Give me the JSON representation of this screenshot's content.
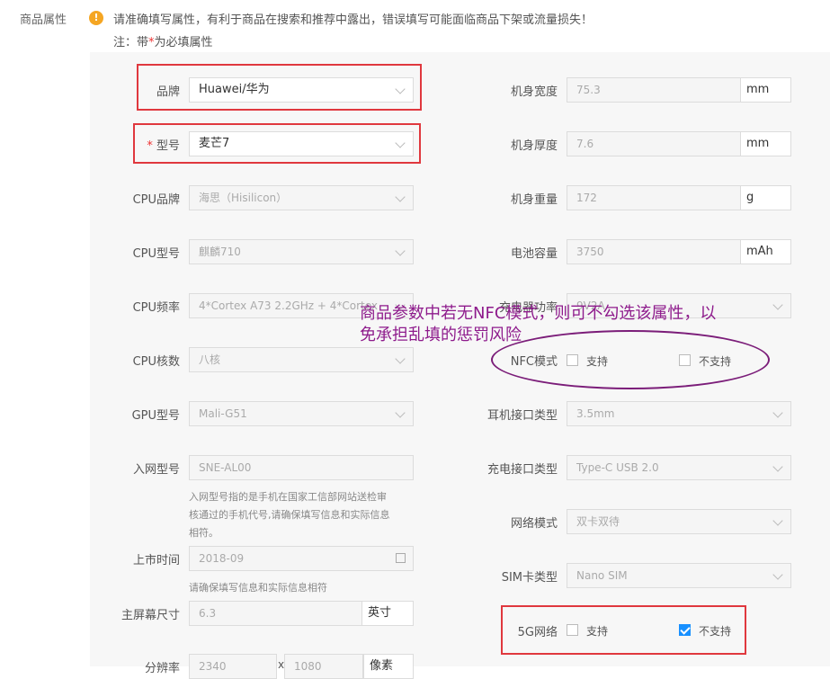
{
  "section_label": "商品属性",
  "warning": {
    "icon": "exclamation-icon",
    "icon_glyph": "!",
    "text": "请准确填写属性，有利于商品在搜索和推荐中露出，错误填写可能面临商品下架或流量损失！"
  },
  "note": {
    "prefix": "注：带",
    "star": "*",
    "suffix": "为必填属性"
  },
  "left": {
    "brand": {
      "label": "品牌",
      "value": "Huawei/华为"
    },
    "model": {
      "star": "*",
      "label": "型号",
      "value": "麦芒7"
    },
    "cpu_brand": {
      "label": "CPU品牌",
      "value": "海思（Hisilicon）"
    },
    "cpu_model": {
      "label": "CPU型号",
      "value": "麒麟710"
    },
    "cpu_freq": {
      "label": "CPU频率",
      "value": "4*Cortex A73 2.2GHz + 4*Cortex"
    },
    "cpu_cores": {
      "label": "CPU核数",
      "value": "八核"
    },
    "gpu_model": {
      "label": "GPU型号",
      "value": "Mali-G51"
    },
    "network_id": {
      "label": "入网型号",
      "value": "SNE-AL00",
      "hint": [
        "入网型号指的是手机在国家工信部网站送检审",
        "核通过的手机代号,请确保填写信息和实际信息",
        "相符。"
      ]
    },
    "release_date": {
      "label": "上市时间",
      "value": "2018-09",
      "hint": "请确保填写信息和实际信息相符"
    },
    "screen_size": {
      "label": "主屏幕尺寸",
      "value": "6.3",
      "unit": "英寸"
    },
    "resolution": {
      "label": "分辨率",
      "value1": "2340",
      "sep": "x",
      "value2": "1080",
      "unit": "像素"
    }
  },
  "right": {
    "width": {
      "label": "机身宽度",
      "value": "75.3",
      "unit": "mm"
    },
    "thickness": {
      "label": "机身厚度",
      "value": "7.6",
      "unit": "mm"
    },
    "weight": {
      "label": "机身重量",
      "value": "172",
      "unit": "g"
    },
    "battery": {
      "label": "电池容量",
      "value": "3750",
      "unit": "mAh"
    },
    "charger": {
      "label": "充电器功率",
      "value": "9V2A"
    },
    "nfc": {
      "label": "NFC模式",
      "opt1": "支持",
      "opt2": "不支持"
    },
    "earphone": {
      "label": "耳机接口类型",
      "value": "3.5mm"
    },
    "charge_port": {
      "label": "充电接口类型",
      "value": "Type-C USB 2.0"
    },
    "network_mode": {
      "label": "网络模式",
      "value": "双卡双待"
    },
    "sim": {
      "label": "SIM卡类型",
      "value": "Nano SIM"
    },
    "g5": {
      "label": "5G网络",
      "opt1": "支持",
      "opt2": "不支持"
    }
  },
  "annotation": {
    "line1": "商品参数中若无NFC模式，则可不勾选该属性，以",
    "line2": "免承担乱填的惩罚风险"
  },
  "colors": {
    "highlight": "#e0383e",
    "annotation": "#8e1b8c",
    "checkbox": "#1890ff",
    "warning": "#f5a623"
  }
}
